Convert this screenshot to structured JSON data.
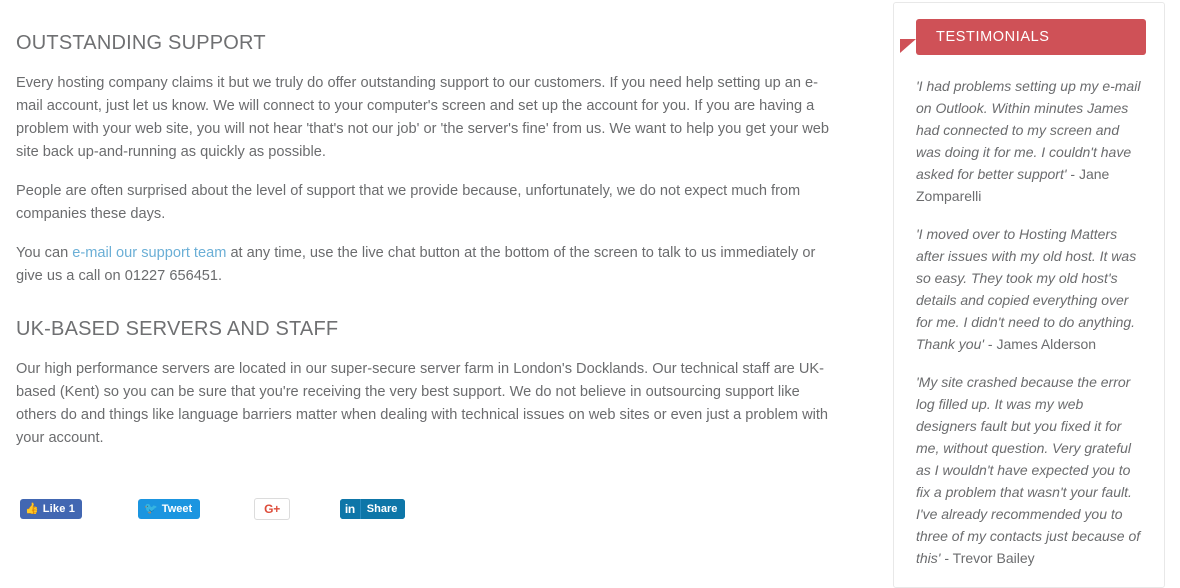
{
  "main": {
    "sections": [
      {
        "heading": "OUTSTANDING SUPPORT",
        "paragraphs": [
          {
            "pre": "Every hosting company claims it but we truly do offer outstanding support to our customers. If you need help setting up an e-mail account, just let us know. We will connect to your computer's screen and set up the account for you. If you are having a problem with your web site, you will not hear 'that's not our job' or 'the server's fine' from us. We want to help you get your web site back up-and-running as quickly as possible.",
            "link": "",
            "post": ""
          },
          {
            "pre": "People are often surprised about the level of support that we provide because, unfortunately, we do not expect much from companies these days.",
            "link": "",
            "post": ""
          },
          {
            "pre": "You can ",
            "link": "e-mail our support team",
            "post": " at any time, use the live chat button at the bottom of the screen to talk to us immediately or give us a call on 01227 656451."
          }
        ]
      },
      {
        "heading": "UK-BASED SERVERS AND STAFF",
        "paragraphs": [
          {
            "pre": "Our high performance servers are located in our super-secure server farm in London's Docklands. Our technical staff are UK-based (Kent) so you can be sure that you're receiving the very best support. We do not believe in outsourcing support like others do and things like language barriers matter when dealing with technical issues on web sites or even just a problem with your account.",
            "link": "",
            "post": ""
          }
        ]
      }
    ]
  },
  "share": {
    "facebook": {
      "icon": "thumbs-up-icon",
      "glyph": "👍",
      "label": "Like 1",
      "color": "#4267b2"
    },
    "twitter": {
      "icon": "twitter-bird-icon",
      "glyph": "🐦",
      "label": "Tweet",
      "color": "#1b95e0"
    },
    "googleplus": {
      "icon": "google-plus-icon",
      "glyph": "G+",
      "label": "",
      "color": "#dd4b39"
    },
    "linkedin": {
      "icon": "linkedin-icon",
      "glyph": "in",
      "label": "Share",
      "color": "#0e76a8"
    }
  },
  "sidebar": {
    "title": "TESTIMONIALS",
    "accent_color": "#cf5157",
    "testimonials": [
      {
        "quote": "'I had problems setting up my e-mail on Outlook. Within minutes James had connected to my screen and was doing it for me. I couldn't have asked for better support'",
        "author": " - Jane Zomparelli"
      },
      {
        "quote": "'I moved over to Hosting Matters after issues with my old host. It was so easy. They took my old host's details and copied everything over for me. I didn't need to do anything. Thank you'",
        "author": " - James Alderson"
      },
      {
        "quote": "'My site crashed because the error log filled up. It was my web designers fault but you fixed it for me, without question. Very grateful as I wouldn't have expected you to fix a problem that wasn't your fault. I've already recommended you to three of my contacts just because of this'",
        "author": " - Trevor Bailey"
      }
    ]
  }
}
